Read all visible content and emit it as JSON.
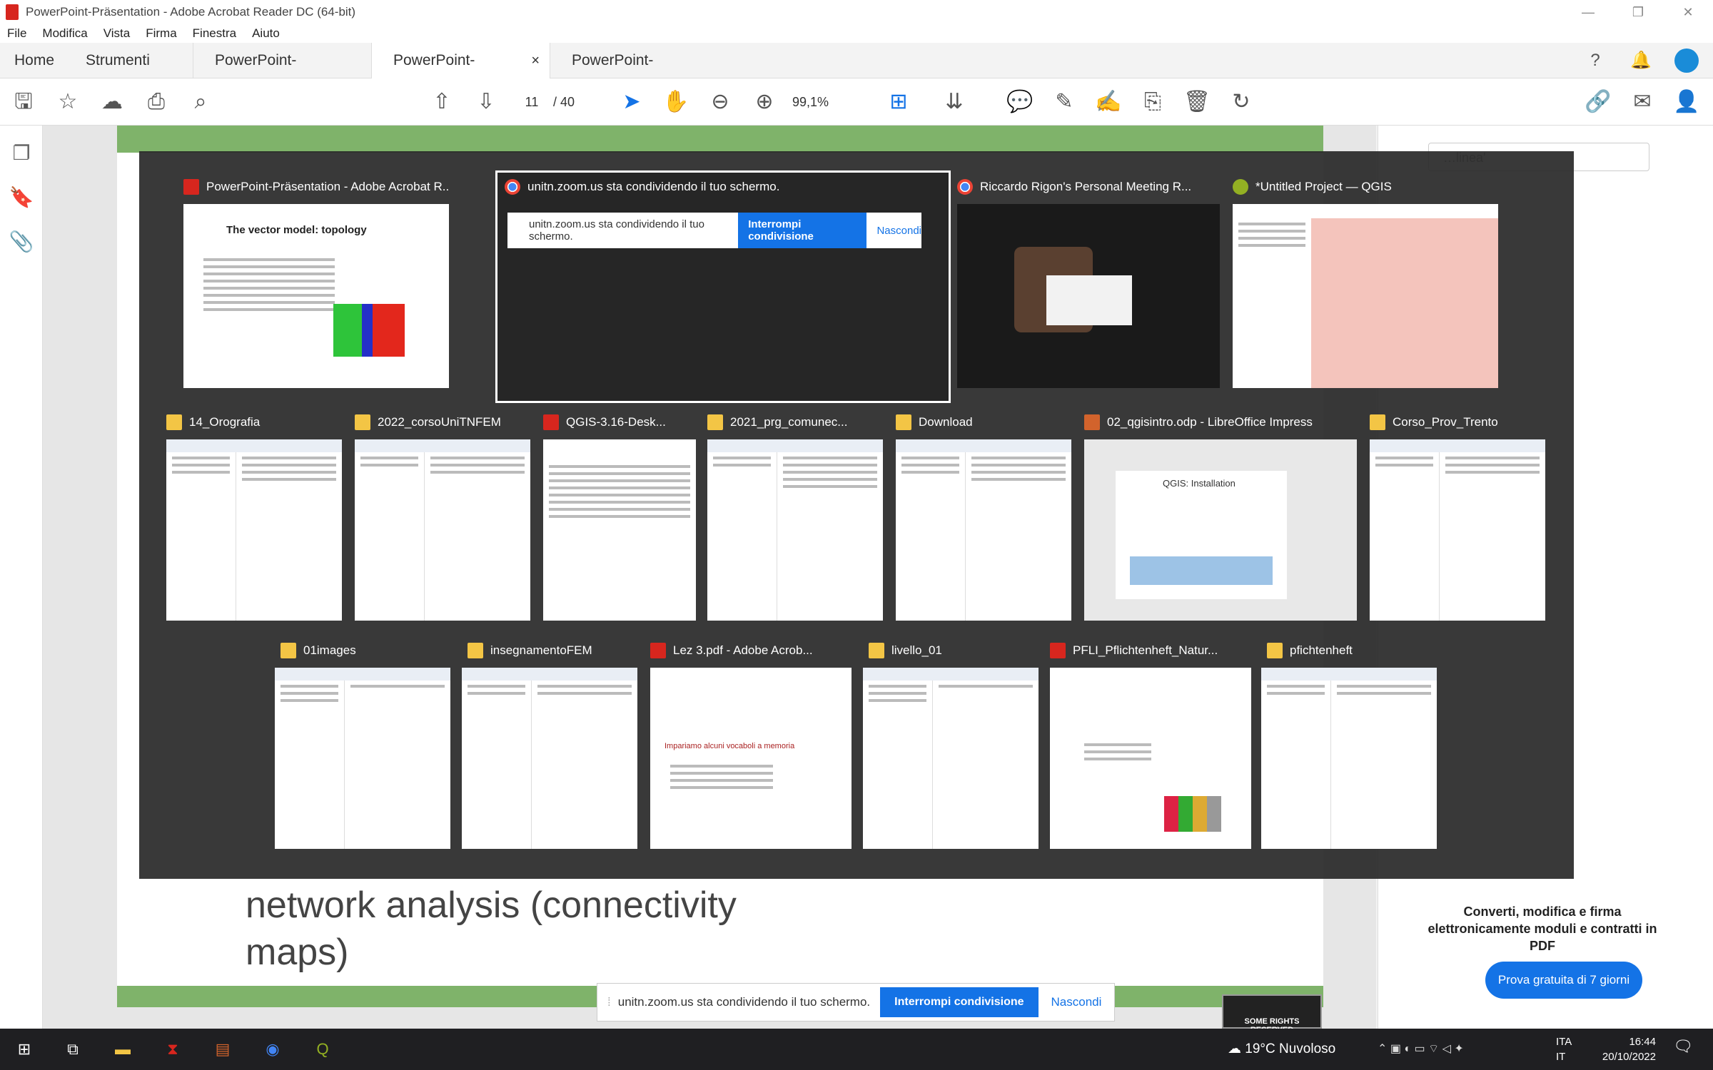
{
  "window": {
    "title": "PowerPoint-Präsentation - Adobe Acrobat Reader DC (64-bit)",
    "controls": [
      "—",
      "❐",
      "✕"
    ]
  },
  "menu": [
    "File",
    "Modifica",
    "Vista",
    "Firma",
    "Finestra",
    "Aiuto"
  ],
  "tabs": {
    "home": "Home",
    "tools": "Strumenti",
    "docs": [
      "PowerPoint-Präsent...",
      "PowerPoint-Präsent...",
      "PowerPoint-Präsent..."
    ],
    "close": "×"
  },
  "toolbar": {
    "page_current": "11",
    "page_total": "/ 40",
    "zoom": "99,1%"
  },
  "slide": {
    "body_line1": "network analysis (connectivity",
    "body_line2": "maps)",
    "band_color": "#7fb36a"
  },
  "right_panel": {
    "search_placeholder": "…linea'",
    "promo": "Converti, modifica e firma elettronicamente moduli e contratti in PDF",
    "trial_button": "Prova gratuita di 7 giorni"
  },
  "switcher": {
    "row1": [
      {
        "title": "PowerPoint-Präsentation - Adobe Acrobat R...",
        "icon": "pdf"
      },
      {
        "title": "unitn.zoom.us sta condividendo il tuo schermo.",
        "icon": "chrome"
      },
      {
        "title": "Riccardo Rigon's Personal Meeting R...",
        "icon": "chrome"
      },
      {
        "title": "*Untitled Project — QGIS",
        "icon": "qgis"
      }
    ],
    "row2": [
      {
        "title": "14_Orografia",
        "icon": "folder"
      },
      {
        "title": "2022_corsoUniTNFEM",
        "icon": "folder"
      },
      {
        "title": "QGIS-3.16-Desk...",
        "icon": "pdf"
      },
      {
        "title": "2021_prg_comunec...",
        "icon": "folder"
      },
      {
        "title": "Download",
        "icon": "folder"
      },
      {
        "title": "02_qgisintro.odp - LibreOffice Impress",
        "icon": "impress"
      },
      {
        "title": "Corso_Prov_Trento",
        "icon": "folder"
      }
    ],
    "row3": [
      {
        "title": "01images",
        "icon": "folder"
      },
      {
        "title": "insegnamentoFEM",
        "icon": "folder"
      },
      {
        "title": "Lez 3.pdf - Adobe Acrob...",
        "icon": "pdf"
      },
      {
        "title": "livello_01",
        "icon": "folder"
      },
      {
        "title": "PFLI_Pflichtenheft_Natur...",
        "icon": "pdf"
      },
      {
        "title": "pfichtenheft",
        "icon": "folder"
      }
    ],
    "thumb_text": {
      "slide_title": "The vector model: topology",
      "zoom_share": "unitn.zoom.us sta condividendo il tuo schermo.",
      "zoom_stop": "Interrompi condivisione",
      "zoom_hide": "Nascondi",
      "impress_title": "QGIS: Installation",
      "lez_heading": "Impariamo alcuni vocaboli a memoria"
    }
  },
  "sharebar": {
    "text": "unitn.zoom.us sta condividendo il tuo schermo.",
    "stop": "Interrompi condivisione",
    "hide": "Nascondi"
  },
  "cc_badge": "SOME RIGHTS RESERVED",
  "taskbar": {
    "weather": "19°C  Nuvoloso",
    "lang1": "ITA",
    "lang2": "IT",
    "time": "16:44",
    "date": "20/10/2022"
  }
}
